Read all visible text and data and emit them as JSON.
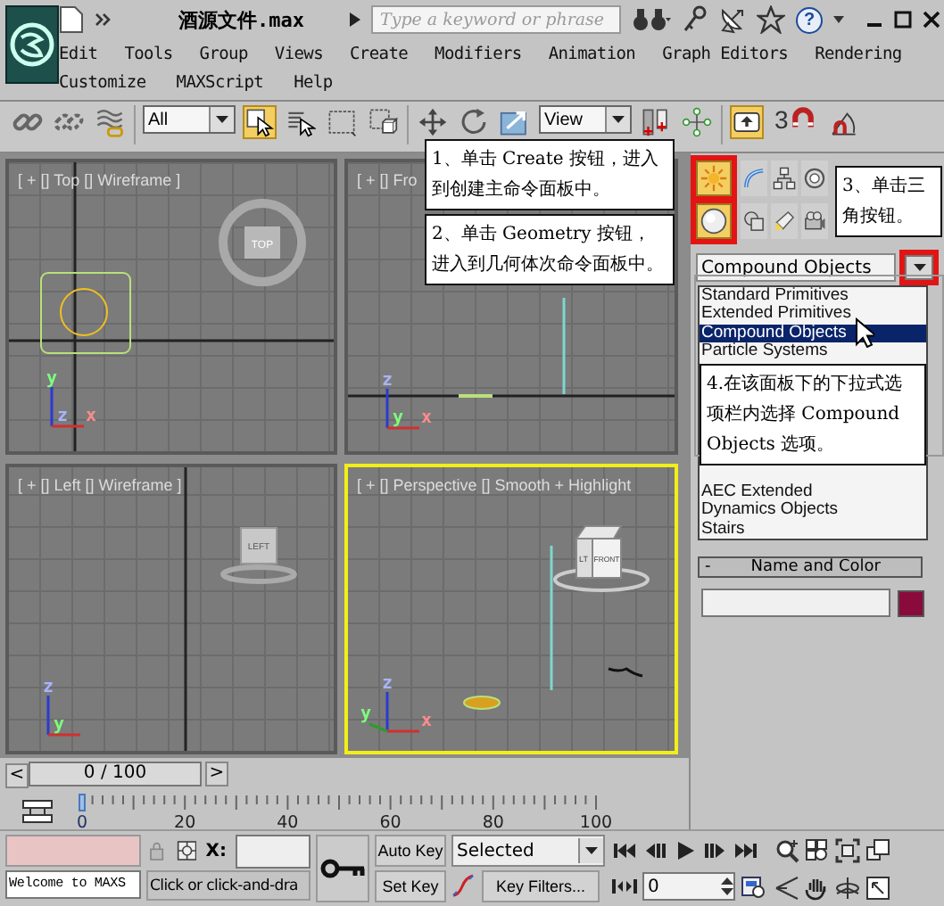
{
  "title_bar": {
    "file_name": "酒源文件.max",
    "search": {
      "placeholder": "Type a keyword or phrase"
    },
    "help": "?"
  },
  "menu_rows": [
    [
      {
        "label": "Edit"
      },
      {
        "label": "Tools"
      },
      {
        "label": "Group"
      },
      {
        "label": "Views"
      },
      {
        "label": "Create"
      },
      {
        "label": "Modifiers"
      },
      {
        "label": "Animation"
      },
      {
        "label": "Graph Editors"
      },
      {
        "label": "Rendering"
      }
    ],
    [
      {
        "label": "Customize"
      },
      {
        "label": "MAXScript"
      },
      {
        "label": "Help"
      }
    ]
  ],
  "toolbar": [
    {
      "kind": "link",
      "selected": false
    },
    {
      "kind": "unlink",
      "selected": false
    },
    {
      "kind": "bind",
      "selected": false
    },
    {
      "kind": "dropdown",
      "value": "All"
    },
    {
      "kind": "select",
      "selected": true
    },
    {
      "kind": "select-by-name",
      "selected": false
    },
    {
      "kind": "region",
      "selected": false
    },
    {
      "kind": "window",
      "selected": false
    },
    {
      "kind": "move",
      "selected": false
    },
    {
      "kind": "rotate",
      "selected": false
    },
    {
      "kind": "scale",
      "selected": false
    },
    {
      "kind": "dropdown",
      "value": "View"
    },
    {
      "kind": "pivot",
      "selected": false
    },
    {
      "kind": "manipulate",
      "selected": false
    },
    {
      "kind": "keyboard",
      "selected": true
    },
    {
      "kind": "snap",
      "value": "3"
    },
    {
      "kind": "angle-snap",
      "selected": false
    }
  ],
  "viewports": [
    {
      "kind": "top",
      "label": "[ + [] Top [] Wireframe ]",
      "active": false,
      "cube_labels": [
        "TOP"
      ],
      "axis_labels": [
        "y",
        "z",
        "x"
      ]
    },
    {
      "kind": "front",
      "label": "[ + [] Fro",
      "active": false,
      "axis_labels": [
        "z",
        "y",
        "x"
      ]
    },
    {
      "kind": "left",
      "label": "[ + [] Left [] Wireframe ]",
      "active": false,
      "cube_labels": [
        "LEFT"
      ],
      "axis_labels": [
        "z",
        "y"
      ]
    },
    {
      "kind": "perspective",
      "label": "[ + [] Perspective [] Smooth + Highlight",
      "active": true,
      "cube_labels": [
        "LT",
        "FRONT"
      ],
      "axis_labels": [
        "z",
        "y",
        "x"
      ]
    }
  ],
  "command_panel": {
    "tabs": [
      {
        "kind": "create",
        "selected": true,
        "highlighted": true
      },
      {
        "kind": "modify",
        "selected": false,
        "highlighted": false
      },
      {
        "kind": "hierarchy",
        "selected": false,
        "highlighted": false
      },
      {
        "kind": "motion",
        "selected": false,
        "highlighted": false
      }
    ],
    "categories": [
      {
        "kind": "geometry",
        "selected": true,
        "highlighted": true
      },
      {
        "kind": "shapes",
        "selected": false,
        "highlighted": false
      },
      {
        "kind": "lights",
        "selected": false,
        "highlighted": false
      },
      {
        "kind": "cameras",
        "selected": false,
        "highlighted": false
      }
    ],
    "object_type": {
      "value": "Compound Objects",
      "arrow_highlighted": true
    },
    "list_top": [
      {
        "label": "Standard Primitives",
        "selected": false
      },
      {
        "label": "Extended Primitives",
        "selected": false
      },
      {
        "label": "Compound Objects",
        "selected": true
      },
      {
        "label": "Particle Systems",
        "selected": false
      }
    ],
    "list_bottom": [
      {
        "label": "AEC Extended",
        "selected": false
      },
      {
        "label": "Dynamics Objects",
        "selected": false
      },
      {
        "label": "Stairs",
        "selected": false
      }
    ],
    "rollout": {
      "toggle": "-",
      "title": "Name and Color",
      "color": "#8a0a3c"
    }
  },
  "timeline": {
    "prev": "<",
    "position": "0 / 100",
    "next": ">",
    "ticks": [
      "0",
      "20",
      "40",
      "60",
      "80",
      "100"
    ]
  },
  "status": {
    "prompt": "Welcome to MAXS",
    "x_label": "X:",
    "hint": "Click or click-and-dra",
    "auto_key": "Auto Key",
    "set_key": "Set Key",
    "key_mode": "Selected",
    "key_filters": "Key Filters...",
    "frame": "0"
  },
  "callouts": [
    {
      "text": "1、单击 Create 按钮，进入到创建主命令面板中。"
    },
    {
      "text": "2、单击 Geometry 按钮，进入到几何体次命令面板中。"
    },
    {
      "text": "3、单击三角按钮。"
    },
    {
      "text": "4.在该面板下的下拉式选项栏内选择 Compound Objects 选项。"
    }
  ]
}
